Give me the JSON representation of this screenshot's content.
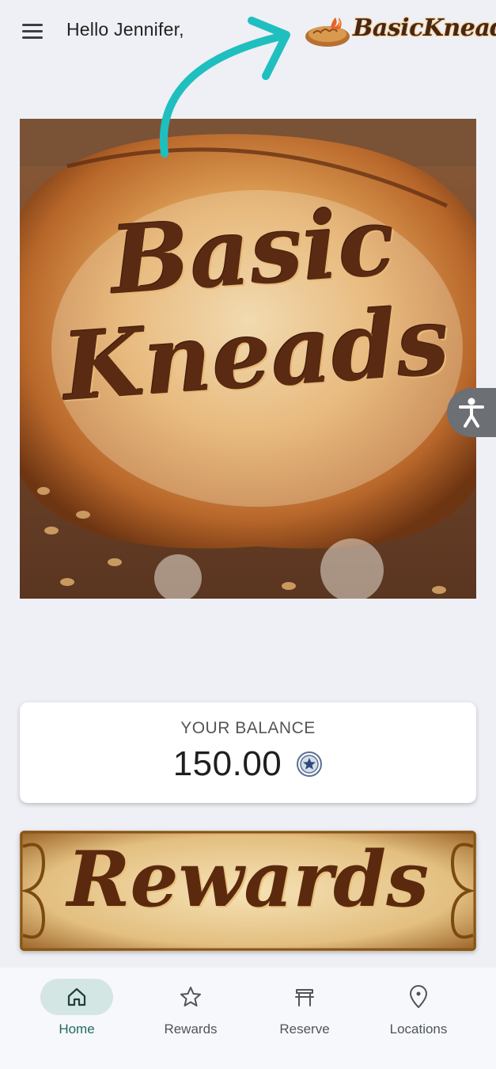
{
  "header": {
    "greeting": "Hello Jennifer,",
    "logo_text": "BasicKneads"
  },
  "hero": {
    "line1": "Basic",
    "line2": "Kneads"
  },
  "balance": {
    "label": "YOUR BALANCE",
    "value": "150.00",
    "icon": "points-star-icon"
  },
  "rewards_banner": {
    "text": "Rewards"
  },
  "nav": {
    "items": [
      {
        "label": "Home",
        "icon": "home-icon",
        "active": true
      },
      {
        "label": "Rewards",
        "icon": "star-icon",
        "active": false
      },
      {
        "label": "Reserve",
        "icon": "table-icon",
        "active": false
      },
      {
        "label": "Locations",
        "icon": "location-pin-icon",
        "active": false
      }
    ]
  },
  "colors": {
    "background": "#eef0f5",
    "accent": "#1e6b63",
    "active_pill": "#d3e6e3",
    "arrow": "#1fbfbf",
    "brand_brown": "#5a2a12"
  }
}
